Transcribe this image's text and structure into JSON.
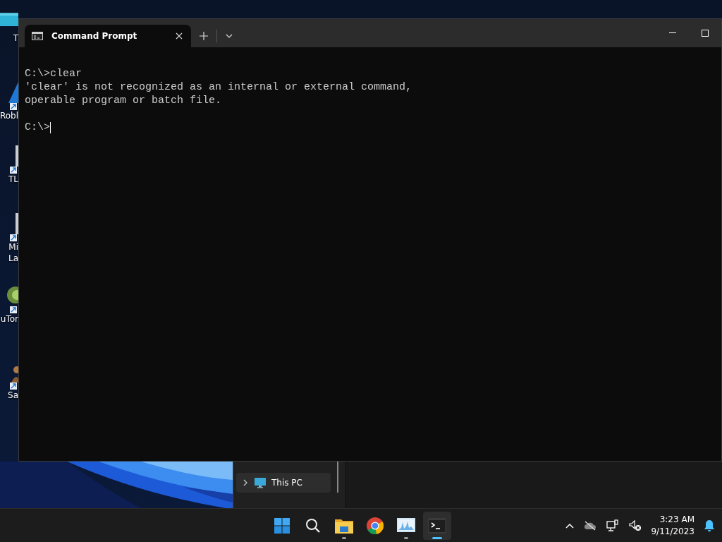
{
  "desktop_icons": [
    {
      "kind": "tile",
      "lines": [
        "T"
      ]
    },
    {
      "kind": "triangle",
      "lines": [
        "Robl"
      ]
    },
    {
      "kind": "document",
      "lines": [
        "TL"
      ]
    },
    {
      "kind": "document",
      "lines": [
        "Mi",
        "La"
      ]
    },
    {
      "kind": "disc",
      "lines": [
        "uTor"
      ]
    },
    {
      "kind": "figure",
      "lines": [
        "Sa"
      ]
    }
  ],
  "explorer": {
    "nav_items": [
      {
        "label": "This PC",
        "selected": true,
        "expanded": false
      }
    ]
  },
  "terminal": {
    "tabs": [
      {
        "title": "Command Prompt",
        "selected": true
      }
    ],
    "lines": [
      "C:\\>clear",
      "'clear' is not recognized as an internal or external command,",
      "operable program or batch file."
    ],
    "prompt": "C:\\>"
  },
  "taskbar": {
    "apps": [
      {
        "kind": "start",
        "running": false,
        "selected": false
      },
      {
        "kind": "search",
        "running": false,
        "selected": false
      },
      {
        "kind": "folder",
        "running": true,
        "selected": false
      },
      {
        "kind": "browser",
        "running": false,
        "selected": false
      },
      {
        "kind": "monitor",
        "running": true,
        "selected": false
      },
      {
        "kind": "terminal",
        "running": true,
        "selected": true
      }
    ],
    "time": "3:23 AM",
    "date": "9/11/2023"
  }
}
